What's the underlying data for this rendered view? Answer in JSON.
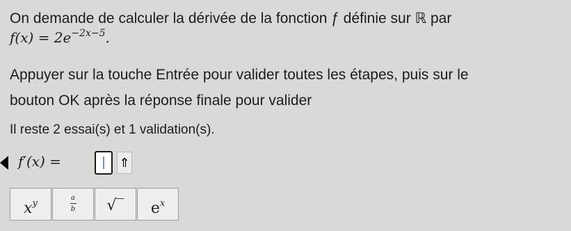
{
  "question": {
    "line1": "On demande de calculer la dérivée de la fonction ƒ définie sur ℝ par",
    "func_lhs": "f(x) = 2e",
    "func_exp": "−2x−5",
    "func_end": "."
  },
  "instructions": {
    "line1": "Appuyer sur la touche Entrée pour valider toutes les étapes, puis sur le",
    "line2": "bouton OK après la réponse finale pour valider"
  },
  "status": {
    "tries": "Il reste 2 essai(s) et 1 validation(s)."
  },
  "answer": {
    "label": "f′(x) =",
    "value": "",
    "up_glyph": "⇑"
  },
  "keypad": {
    "power_base": "x",
    "power_exp": "y",
    "frac_num": "a",
    "frac_den": "b",
    "sqrt": "√‾",
    "exp_base": "e",
    "exp_exp": "x"
  }
}
